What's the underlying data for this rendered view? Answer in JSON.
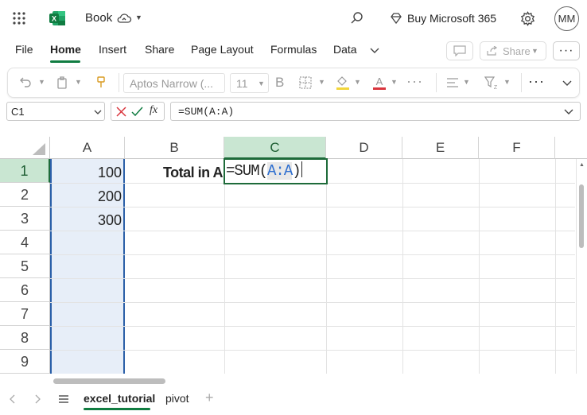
{
  "app": {
    "title": "Book",
    "buy_label": "Buy Microsoft 365",
    "avatar_initials": "MM",
    "brand_color": "#107C41"
  },
  "menu": {
    "items": [
      "File",
      "Home",
      "Insert",
      "Share",
      "Page Layout",
      "Formulas",
      "Data"
    ],
    "active": "Home",
    "share_label": "Share"
  },
  "ribbon": {
    "font_name": "Aptos Narrow (...",
    "font_size": "11"
  },
  "formula_bar": {
    "name_box": "C1",
    "fx_label": "fx",
    "formula": "=SUM(A:A)"
  },
  "grid": {
    "columns": [
      "A",
      "B",
      "C",
      "D",
      "E",
      "F"
    ],
    "rows": [
      "1",
      "2",
      "3",
      "4",
      "5",
      "6",
      "7",
      "8",
      "9"
    ],
    "cells": {
      "A1": "100",
      "A2": "200",
      "A3": "300",
      "B1": "Total in A"
    },
    "edit_cell": {
      "prefix": "=SUM(",
      "range": "A:A",
      "suffix": ")"
    }
  },
  "sheets": {
    "tabs": [
      "excel_tutorial",
      "pivot"
    ],
    "active": "excel_tutorial"
  },
  "colors": {
    "selection_border": "#1e6b3a",
    "selected_header_bg": "#c9e6d2",
    "range_border": "#2a5fa8",
    "range_fill": "#e7eef8",
    "range_text": "#2f6fd0"
  }
}
